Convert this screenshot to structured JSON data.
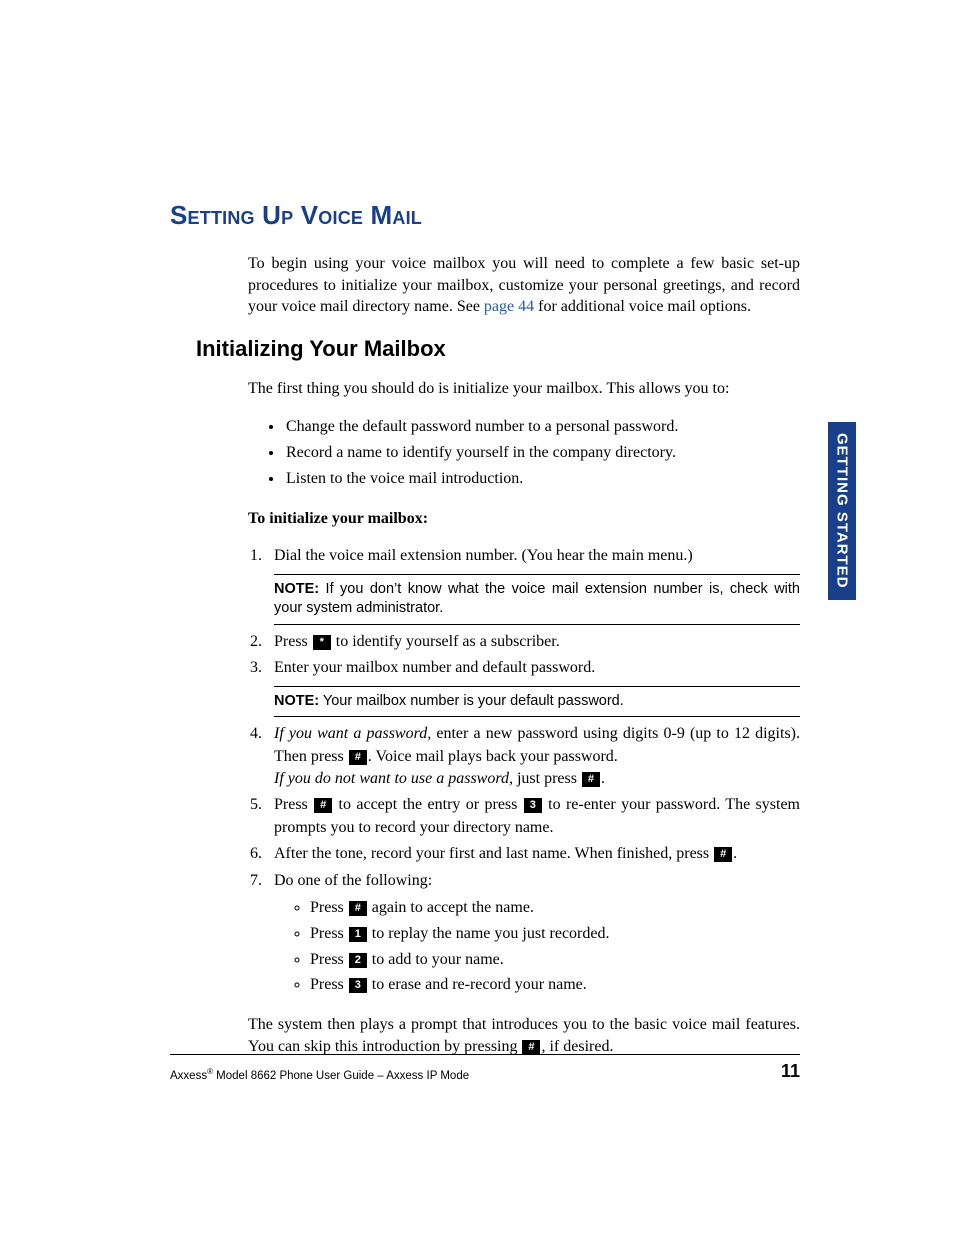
{
  "headings": {
    "h1": "Setting Up Voice Mail",
    "h2": "Initializing Your Mailbox"
  },
  "intro": {
    "part1": "To begin using your voice mailbox you will need to complete a few basic set-up procedures to initialize your mailbox, customize your personal greetings, and record your voice mail directory name. See ",
    "link": "page 44",
    "part2": " for additional voice mail options."
  },
  "paragraphs": {
    "p1": "The first thing you should do is initialize your mailbox. This allows you to:",
    "toinit": "To initialize your mailbox:",
    "closing": "The system then plays a prompt that introduces you to the basic voice mail features. You can skip this introduction by pressing ",
    "closing_after": ", if desired."
  },
  "bullets": {
    "b1": "Change the default password number to a personal password.",
    "b2": "Record a name to identify yourself in the company directory.",
    "b3": "Listen to the voice mail introduction."
  },
  "steps": {
    "s1": "Dial the voice mail extension number. (You hear the main menu.)",
    "s2_before": "Press ",
    "s2_after": " to identify yourself as a subscriber.",
    "s3": "Enter your mailbox number and default password.",
    "s4_italic1": "If you want a password,",
    "s4_text1": " enter a new password using digits 0-9 (up to 12 digits). Then press ",
    "s4_text2": ". Voice mail plays back your password.",
    "s4_italic2": "If you do not want to use a password,",
    "s4_text3": " just press ",
    "s5_before": "Press ",
    "s5_mid1": " to accept the entry or press ",
    "s5_mid2": " to re-enter your password. The system prompts you to record your directory name.",
    "s6_before": "After the tone, record your first and last name. When finished, press ",
    "s7": "Do one of the following:"
  },
  "substeps": {
    "a_before": "Press ",
    "a_after": " again to accept the name.",
    "b_before": "Press ",
    "b_after": " to replay the name you just recorded.",
    "c_before": "Press ",
    "c_after": " to add to your name.",
    "d_before": "Press ",
    "d_after": " to erase and re-record your name."
  },
  "notes": {
    "label": "NOTE:",
    "n1": " If you don’t know what the voice mail extension number is, check with your system administrator.",
    "n2": " Your mailbox number is your default password."
  },
  "keys": {
    "star": "*",
    "hash": "#",
    "one": "1",
    "two": "2",
    "three": "3"
  },
  "sidebar": "GETTING STARTED",
  "footer": {
    "brand": "Axxess",
    "reg": "®",
    "text": "  Model 8662 Phone User Guide – Axxess IP Mode",
    "page": "11"
  }
}
